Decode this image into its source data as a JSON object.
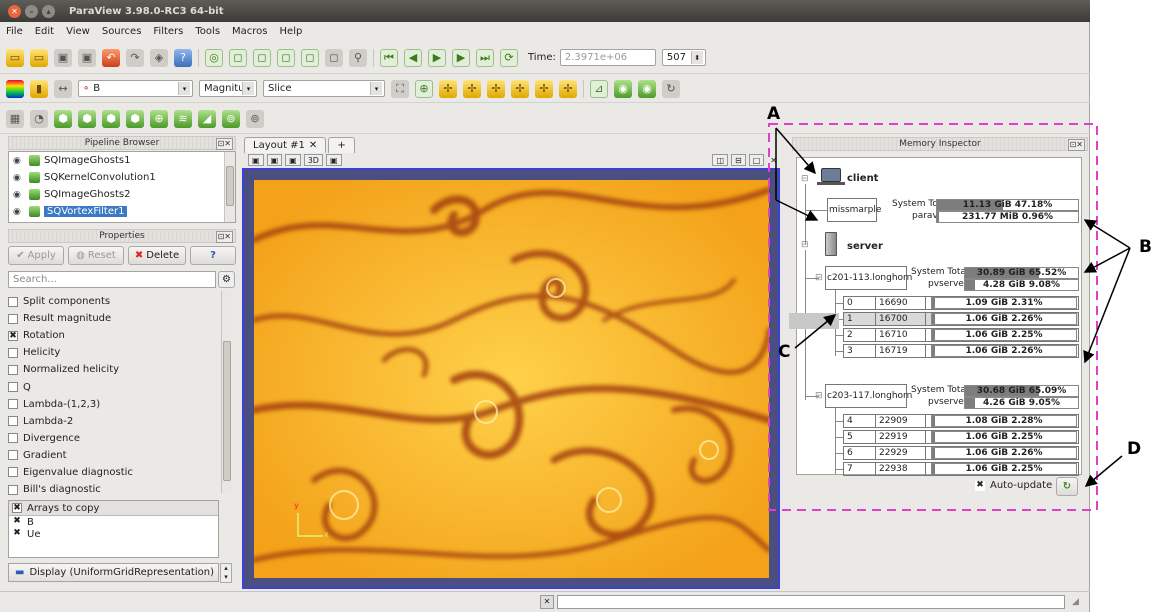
{
  "window": {
    "title": "ParaView 3.98.0-RC3 64-bit"
  },
  "menu": [
    "File",
    "Edit",
    "View",
    "Sources",
    "Filters",
    "Tools",
    "Macros",
    "Help"
  ],
  "toolbar1": {
    "time_label": "Time:",
    "time_value": "2.3971e+06",
    "step_value": "507"
  },
  "toolbar2": {
    "array_combo": "B",
    "component_combo": "Magnituc",
    "representation_combo": "Slice"
  },
  "pipeline": {
    "title": "Pipeline Browser",
    "items": [
      "SQImageGhosts1",
      "SQKernelConvolution1",
      "SQImageGhosts2",
      "SQVortexFilter1"
    ]
  },
  "properties": {
    "title": "Properties",
    "apply": "Apply",
    "reset": "Reset",
    "delete": "Delete",
    "help": "?",
    "search_placeholder": "Search...",
    "items": [
      {
        "label": "Split components",
        "checked": false
      },
      {
        "label": "Result magnitude",
        "checked": false
      },
      {
        "label": "Rotation",
        "checked": true
      },
      {
        "label": "Helicity",
        "checked": false
      },
      {
        "label": "Normalized helicity",
        "checked": false
      },
      {
        "label": "Q",
        "checked": false
      },
      {
        "label": "Lambda-(1,2,3)",
        "checked": false
      },
      {
        "label": "Lambda-2",
        "checked": false
      },
      {
        "label": "Divergence",
        "checked": false
      },
      {
        "label": "Gradient",
        "checked": false
      },
      {
        "label": "Eigenvalue diagnostic",
        "checked": false
      },
      {
        "label": "Bill's diagnostic",
        "checked": false
      }
    ],
    "arrays_header": "Arrays to copy",
    "arrays": [
      "B",
      "Ue"
    ],
    "display": "Display (UniformGridRepresentation)"
  },
  "layout": {
    "tab": "Layout #1",
    "add": "+",
    "view3d": "3D",
    "axis_x": "x",
    "axis_y": "y"
  },
  "memory": {
    "title": "Memory Inspector",
    "client_label": "client",
    "client_host": "missmarple",
    "client_rows": [
      {
        "label": "System Total",
        "text": "11.13 GiB 47.18%",
        "fraction": 0.47
      },
      {
        "label": "paraview",
        "text": "231.77 MiB 0.96%",
        "fraction": 0.01
      }
    ],
    "server_label": "server",
    "nodes": [
      {
        "host": "c201-113.longhorn",
        "system_total": {
          "label": "System Total",
          "text": "30.89 GiB 65.52%",
          "fraction": 0.655
        },
        "pvserver": {
          "label": "pvserver",
          "text": "4.28 GiB 9.08%",
          "fraction": 0.09
        },
        "ranks": [
          {
            "rank": "0",
            "pid": "16690",
            "text": "1.09 GiB 2.31%",
            "fraction": 0.023
          },
          {
            "rank": "1",
            "pid": "16700",
            "text": "1.06 GiB 2.26%",
            "fraction": 0.023
          },
          {
            "rank": "2",
            "pid": "16710",
            "text": "1.06 GiB 2.25%",
            "fraction": 0.023
          },
          {
            "rank": "3",
            "pid": "16719",
            "text": "1.06 GiB 2.26%",
            "fraction": 0.023
          }
        ]
      },
      {
        "host": "c203-117.longhorn",
        "system_total": {
          "label": "System Total",
          "text": "30.68 GiB 65.09%",
          "fraction": 0.651
        },
        "pvserver": {
          "label": "pvserver",
          "text": "4.26 GiB 9.05%",
          "fraction": 0.09
        },
        "ranks": [
          {
            "rank": "4",
            "pid": "22909",
            "text": "1.08 GiB 2.28%",
            "fraction": 0.023
          },
          {
            "rank": "5",
            "pid": "22919",
            "text": "1.06 GiB 2.25%",
            "fraction": 0.023
          },
          {
            "rank": "6",
            "pid": "22929",
            "text": "1.06 GiB 2.26%",
            "fraction": 0.023
          },
          {
            "rank": "7",
            "pid": "22938",
            "text": "1.06 GiB 2.25%",
            "fraction": 0.023
          }
        ]
      }
    ],
    "auto_update": "Auto-update"
  },
  "annotations": {
    "a": "A",
    "b": "B",
    "c": "C",
    "d": "D"
  },
  "colors": {
    "accent": "#3b79c4",
    "dash_box": "#e040c8",
    "view_border": "#3a40d8"
  }
}
